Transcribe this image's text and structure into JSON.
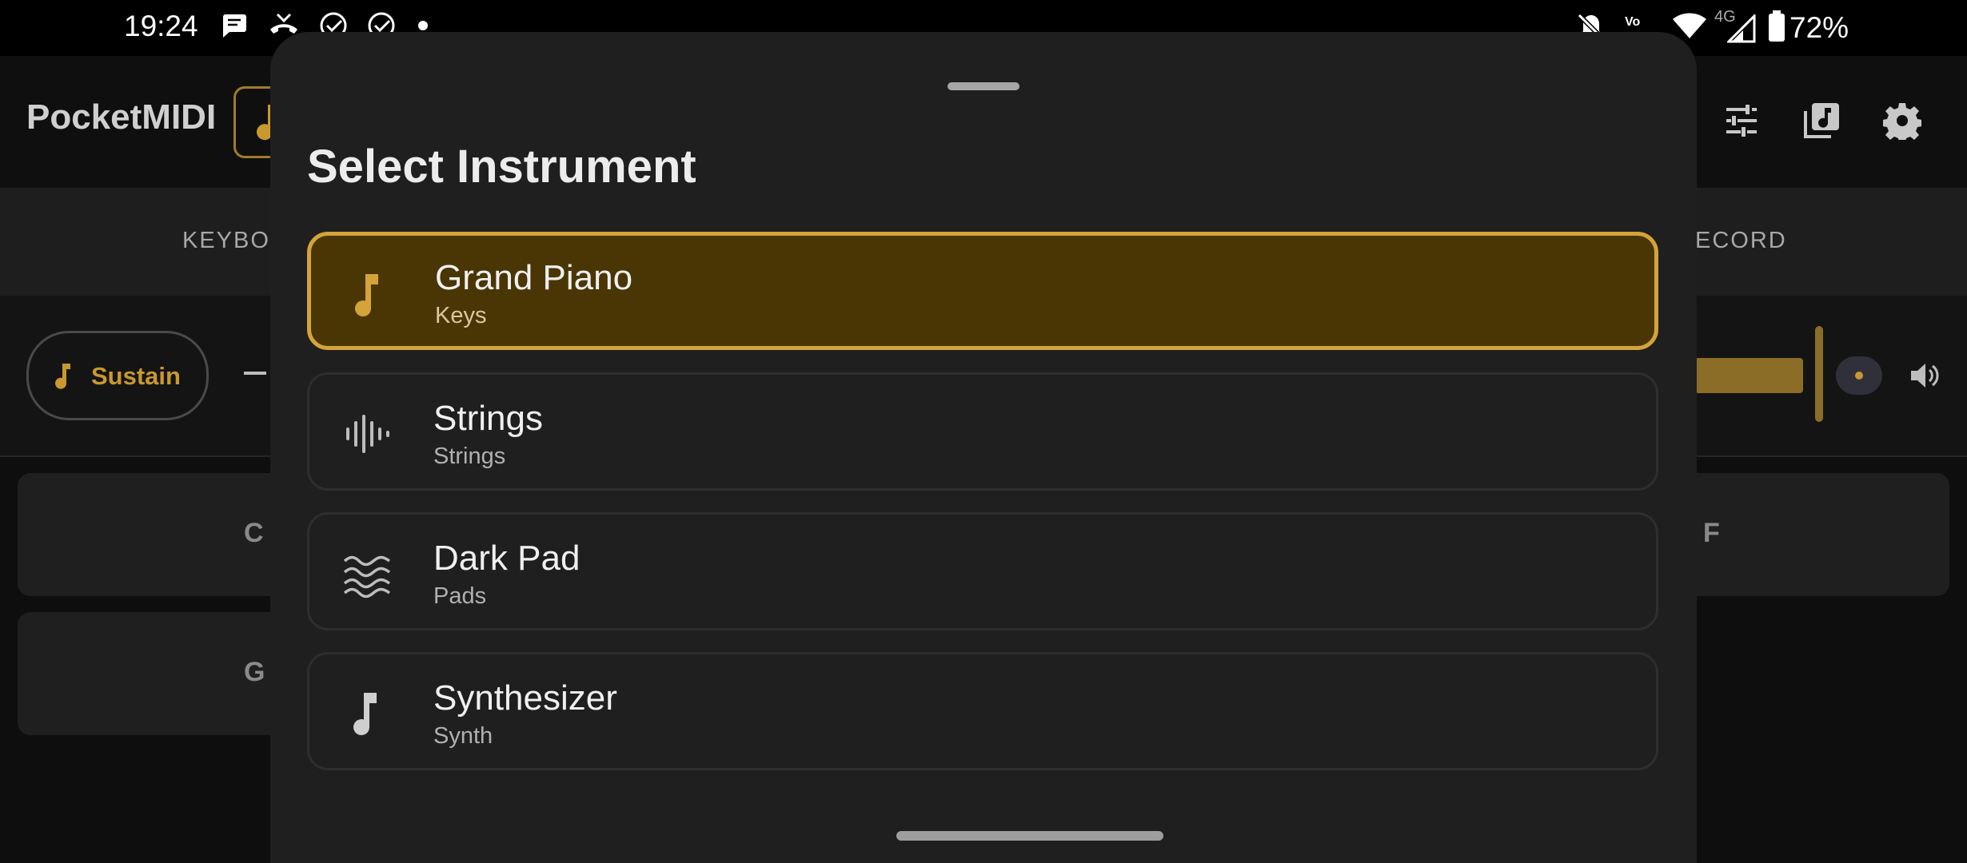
{
  "status_bar": {
    "time": "19:24",
    "network": "4G",
    "volte": "Vo LTE",
    "battery": "72%",
    "left_icons": [
      "chat-bubble-icon",
      "missed-call-icon",
      "check-circle-icon",
      "check-circle-icon",
      "dot-icon"
    ],
    "right_icons": [
      "bell-off-icon",
      "volte-icon",
      "wifi-icon",
      "signal-icon",
      "battery-icon"
    ]
  },
  "app": {
    "title": "PocketMIDI"
  },
  "tabs": {
    "keyboard_label": "KEYBOA",
    "record_label": "ECORD"
  },
  "controls": {
    "sustain_label": "Sustain"
  },
  "pads": {
    "c": "C",
    "f": "F",
    "g": "G"
  },
  "sheet": {
    "title": "Select Instrument",
    "instruments": [
      {
        "name": "Grand Piano",
        "category": "Keys",
        "icon": "music-note-icon",
        "selected": true
      },
      {
        "name": "Strings",
        "category": "Strings",
        "icon": "waveform-icon",
        "selected": false
      },
      {
        "name": "Dark Pad",
        "category": "Pads",
        "icon": "waves-icon",
        "selected": false
      },
      {
        "name": "Synthesizer",
        "category": "Synth",
        "icon": "music-note-icon",
        "selected": false
      }
    ]
  },
  "colors": {
    "accent": "#d4a33a",
    "selected_bg": "#4a3605",
    "sheet_bg": "#1f1f1f",
    "app_bg": "#0e0e0e"
  }
}
